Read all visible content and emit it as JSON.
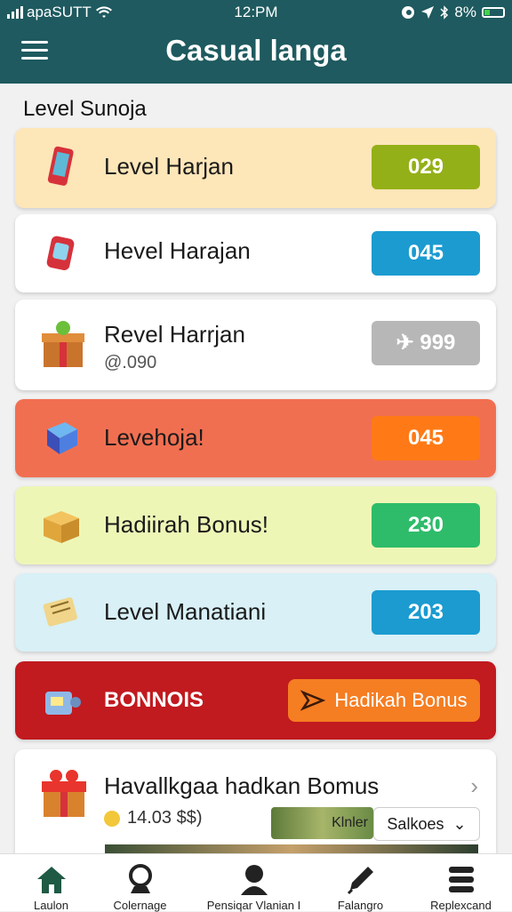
{
  "status_bar": {
    "carrier": "apaSUTT",
    "time": "12:PM",
    "battery": "8%",
    "icons": [
      "signal-icon",
      "wifi-icon",
      "alarm-icon",
      "location-icon",
      "bluetooth-icon",
      "battery-icon"
    ]
  },
  "app_bar": {
    "title": "Casual langa",
    "menu_icon": "hamburger-menu-icon"
  },
  "section_label": "Level Sunoja",
  "cards": [
    {
      "label": "Level Harjan",
      "value": "029",
      "icon": "phone-icon",
      "bg": "#fde6b8",
      "pill": "#94b018"
    },
    {
      "label": "Hevel Harajan",
      "value": "045",
      "icon": "tag-icon",
      "bg": "#ffffff",
      "pill": "#1b9bd0"
    },
    {
      "label": "Revel Harrjan",
      "sub": "@.090",
      "value": "999",
      "icon": "gift-box-icon",
      "bg": "#ffffff",
      "pill": "#b7b7b7"
    },
    {
      "label": "Levehoja!",
      "value": "045",
      "icon": "cube-icon",
      "bg": "#f16f51",
      "pill": "#ff7a16"
    },
    {
      "label": "Hadiirah Bonus!",
      "value": "230",
      "icon": "box-icon",
      "bg": "#eef6b6",
      "pill": "#2ebc6a"
    },
    {
      "label": "Level Manatiani",
      "value": "203",
      "icon": "ticket-icon",
      "bg": "#d8f0f6",
      "pill": "#1b9bd0"
    }
  ],
  "bonus_banner": {
    "label": "BONNOIS",
    "button_label": "Hadikah Bonus",
    "bg": "#c11a1f",
    "icon": "bonus-machine-icon"
  },
  "reward_card": {
    "title": "Havallkgaa hadkan Bomus",
    "price": "14.03 $$)",
    "image_text": "Klnler",
    "dropdown_value": "Salkoes",
    "icon": "gift-icon"
  },
  "bottom_nav": [
    {
      "label": "Laulon",
      "icon": "home-icon"
    },
    {
      "label": "Colernage",
      "icon": "pin-icon"
    },
    {
      "label": "Pensiqar Vlanian I",
      "icon": "profile-icon"
    },
    {
      "label": "Falangro",
      "icon": "pencil-icon"
    },
    {
      "label": "Replexcand",
      "icon": "list-icon"
    }
  ]
}
